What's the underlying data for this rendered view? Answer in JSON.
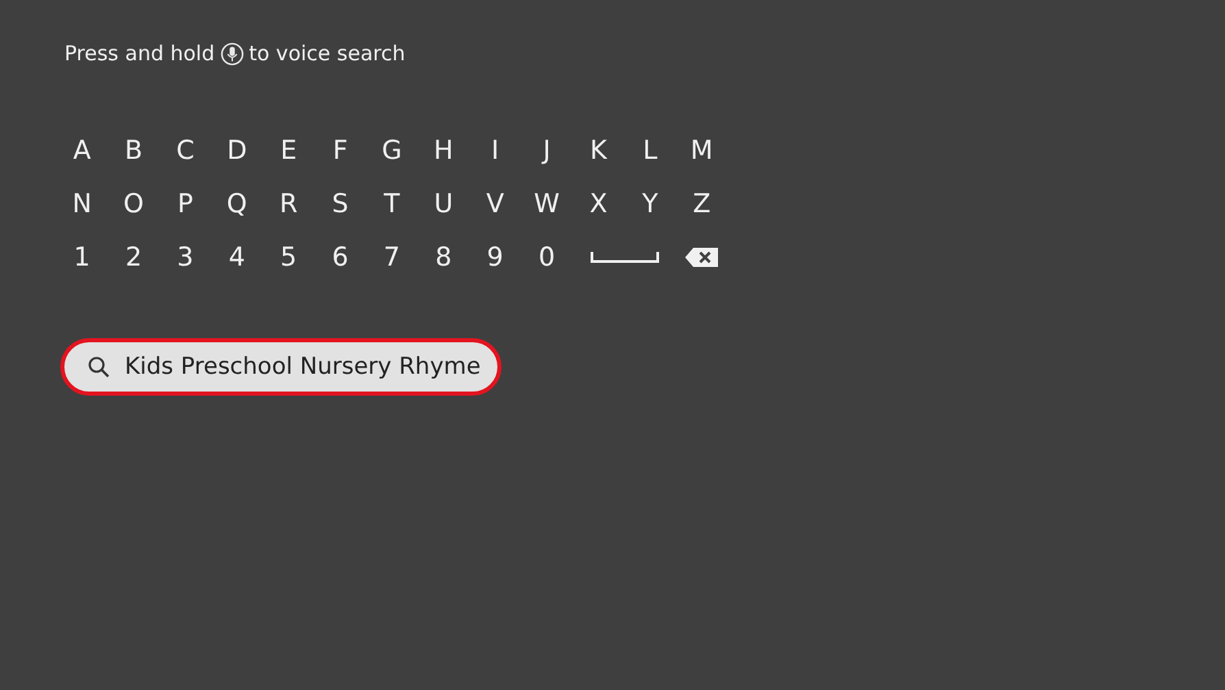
{
  "prompt": {
    "before": "Press and hold",
    "after": "to voice search"
  },
  "keyboard": {
    "rows": [
      [
        {
          "kind": "char",
          "label": "A"
        },
        {
          "kind": "char",
          "label": "B"
        },
        {
          "kind": "char",
          "label": "C"
        },
        {
          "kind": "char",
          "label": "D"
        },
        {
          "kind": "char",
          "label": "E"
        },
        {
          "kind": "char",
          "label": "F"
        },
        {
          "kind": "char",
          "label": "G"
        },
        {
          "kind": "char",
          "label": "H"
        },
        {
          "kind": "char",
          "label": "I"
        },
        {
          "kind": "char",
          "label": "J"
        },
        {
          "kind": "char",
          "label": "K"
        },
        {
          "kind": "char",
          "label": "L"
        },
        {
          "kind": "char",
          "label": "M"
        }
      ],
      [
        {
          "kind": "char",
          "label": "N"
        },
        {
          "kind": "char",
          "label": "O"
        },
        {
          "kind": "char",
          "label": "P"
        },
        {
          "kind": "char",
          "label": "Q"
        },
        {
          "kind": "char",
          "label": "R"
        },
        {
          "kind": "char",
          "label": "S"
        },
        {
          "kind": "char",
          "label": "T"
        },
        {
          "kind": "char",
          "label": "U"
        },
        {
          "kind": "char",
          "label": "V"
        },
        {
          "kind": "char",
          "label": "W"
        },
        {
          "kind": "char",
          "label": "X"
        },
        {
          "kind": "char",
          "label": "Y"
        },
        {
          "kind": "char",
          "label": "Z"
        }
      ],
      [
        {
          "kind": "char",
          "label": "1"
        },
        {
          "kind": "char",
          "label": "2"
        },
        {
          "kind": "char",
          "label": "3"
        },
        {
          "kind": "char",
          "label": "4"
        },
        {
          "kind": "char",
          "label": "5"
        },
        {
          "kind": "char",
          "label": "6"
        },
        {
          "kind": "char",
          "label": "7"
        },
        {
          "kind": "char",
          "label": "8"
        },
        {
          "kind": "char",
          "label": "9"
        },
        {
          "kind": "char",
          "label": "0"
        },
        {
          "kind": "space"
        },
        {
          "kind": "backspace"
        }
      ]
    ]
  },
  "search": {
    "value": "Kids Preschool Nursery Rhyme",
    "focused": true
  }
}
